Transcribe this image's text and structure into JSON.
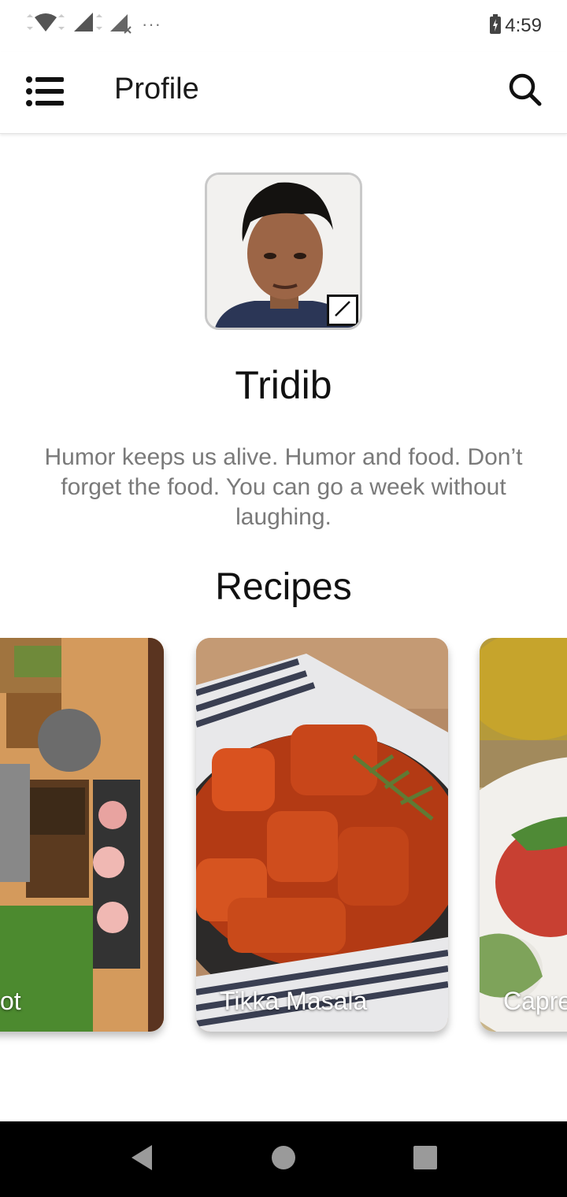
{
  "status_bar": {
    "time": "4:59",
    "overflow": "···",
    "icons": [
      "wifi-icon",
      "signal-icon",
      "signal-no-sim-icon",
      "battery-charging-icon"
    ]
  },
  "app_bar": {
    "title": "Profile",
    "menu_icon": "list-menu-icon",
    "search_icon": "search-icon"
  },
  "profile": {
    "name": "Tridib",
    "bio": "Humor keeps us alive. Humor and food. Don’t forget the food. You can go a week without laughing.",
    "edit_icon": "edit-pencil-icon"
  },
  "recipes": {
    "title": "Recipes",
    "cards": [
      {
        "label": "ot"
      },
      {
        "label": "Tikka Masala"
      },
      {
        "label": "Capre"
      }
    ]
  },
  "nav_bar": {
    "icons": [
      "back-icon",
      "home-icon",
      "recents-icon"
    ]
  },
  "colors": {
    "background": "#ffffff",
    "bio_text": "#7a7a7a",
    "nav_bar": "#000000"
  }
}
